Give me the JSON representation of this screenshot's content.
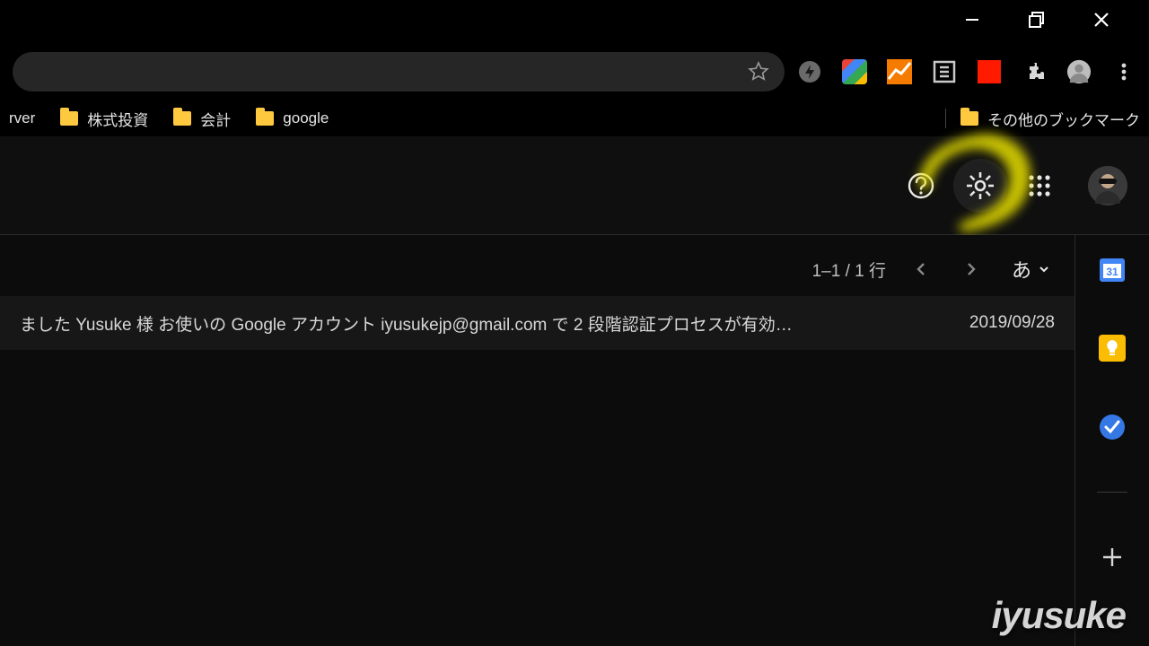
{
  "bookmarks": {
    "b0": "rver",
    "b1": "株式投資",
    "b2": "会計",
    "b3": "google",
    "other": "その他のブックマーク"
  },
  "toolbar": {
    "counter": "1–1 / 1 行",
    "ime": "あ"
  },
  "message": {
    "text": "ました Yusuke 様 お使いの Google アカウント iyusukejp@gmail.com で 2 段階認証プロセスが有効…",
    "date": "2019/09/28"
  },
  "sidepanel": {
    "calendar_day": "31"
  },
  "watermark": "iyusuke"
}
